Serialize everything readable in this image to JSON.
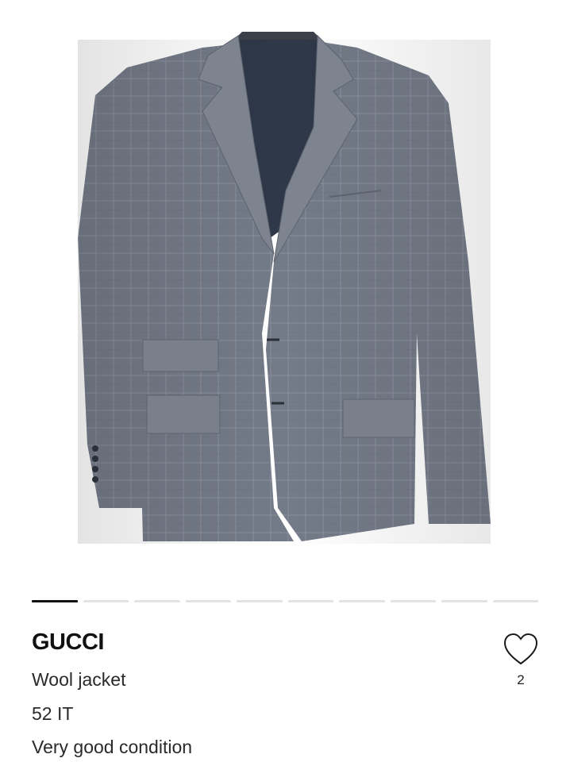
{
  "product": {
    "brand": "GUCCI",
    "title": "Wool jacket",
    "size": "52 IT",
    "condition": "Very good condition",
    "image_alt": "Grey plaid wool blazer on hanger"
  },
  "gallery": {
    "total_slides": 10,
    "active_index": 0
  },
  "favorite": {
    "icon": "heart-outline-icon",
    "count": "2"
  },
  "colors": {
    "jacket": "#737a86",
    "lining": "#2f3848",
    "accent": "#111111"
  }
}
